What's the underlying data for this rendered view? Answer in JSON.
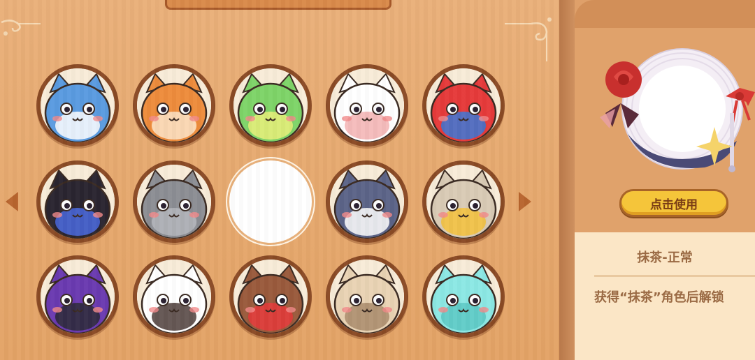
{
  "avatars": [
    {
      "name": "blue-cat",
      "color": "#5a9be0",
      "accent": "#ffffff"
    },
    {
      "name": "orange-owl-cat",
      "color": "#ee8c3c",
      "accent": "#fbe4c8"
    },
    {
      "name": "green-cat",
      "color": "#7ed468",
      "accent": "#e9f07a"
    },
    {
      "name": "white-calico-cat",
      "color": "#ffffff",
      "accent": "#f3b0b0"
    },
    {
      "name": "clown-cat",
      "color": "#e63a3a",
      "accent": "#3a78d8"
    },
    {
      "name": "black-cat",
      "color": "#2a2530",
      "accent": "#4a6ae0"
    },
    {
      "name": "gray-cat",
      "color": "#8c8e94",
      "accent": "#b4b6bc"
    },
    {
      "name": "empty-slot",
      "color": "#ffffff",
      "accent": "#ffffff"
    },
    {
      "name": "penguin-cat",
      "color": "#5c6488",
      "accent": "#ffffff"
    },
    {
      "name": "cheese-helmet-cat",
      "color": "#d9cbb5",
      "accent": "#f4c23a"
    },
    {
      "name": "hooded-ninja-cat",
      "color": "#6a3ab0",
      "accent": "#2a2a36"
    },
    {
      "name": "panda-cat",
      "color": "#ffffff",
      "accent": "#4a3a36"
    },
    {
      "name": "reindeer-cat",
      "color": "#9a5a3c",
      "accent": "#e63a3a"
    },
    {
      "name": "tabby-cat",
      "color": "#e9d3b4",
      "accent": "#a88a6a"
    },
    {
      "name": "robot-cyan-cat",
      "color": "#8ce8e4",
      "accent": "#5ac8c4"
    }
  ],
  "navigation": {
    "prev_icon": "chevron-left-icon",
    "next_icon": "chevron-right-icon"
  },
  "preview": {
    "frame_icon": "lace-rose-ribbon-frame-icon"
  },
  "use_button": {
    "label": "点击使用"
  },
  "info": {
    "title": "抹茶-正常",
    "description": "获得“抹茶”角色后解锁"
  },
  "colors": {
    "board": "#e6a96f",
    "slot_ring": "#8a4a25",
    "button": "#f5c53a",
    "info_bg": "#fbe6c6",
    "text": "#9a6a44"
  }
}
